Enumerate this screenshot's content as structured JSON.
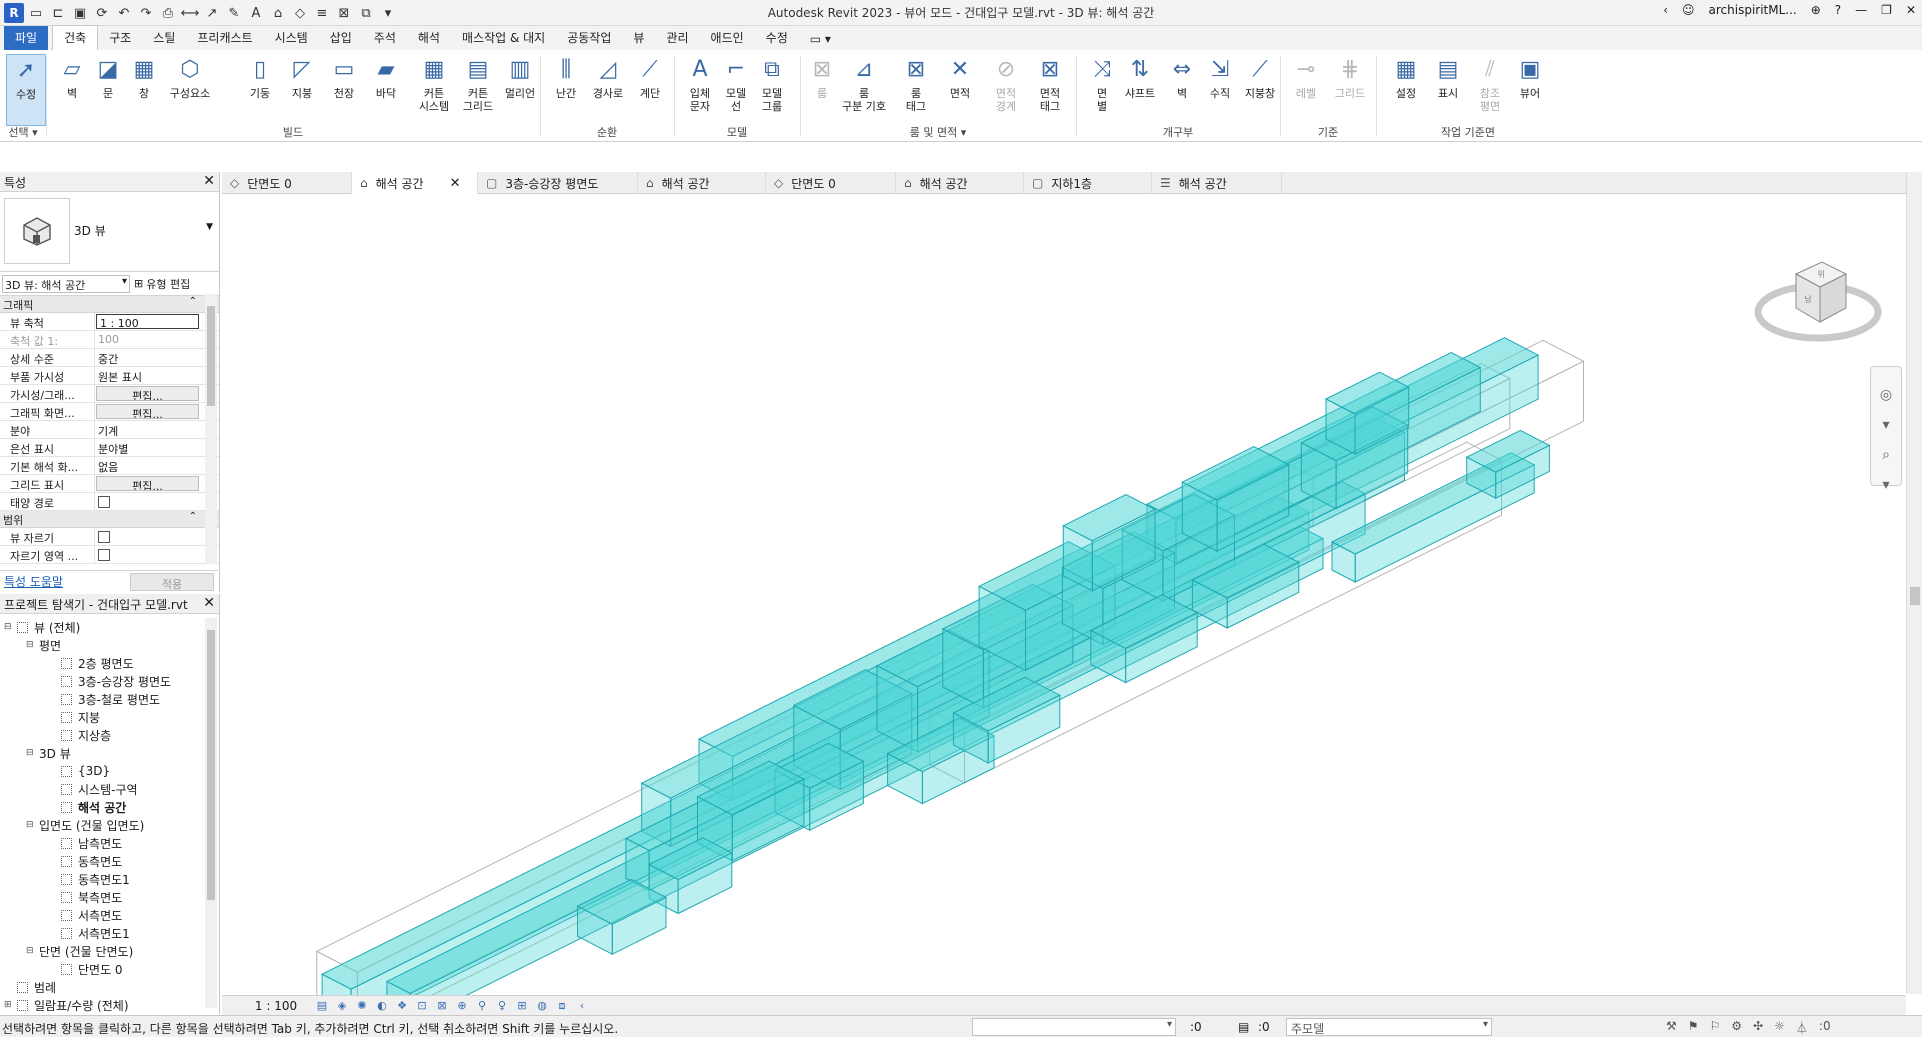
{
  "titlebar": {
    "title": "Autodesk Revit 2023 - 뷰어 모드 - 건대입구 모델.rvt - 3D 뷰: 해석 공간",
    "app_logo": "R",
    "user": "archispiritML...",
    "icons": [
      "revit-logo-icon",
      "open-icon",
      "save-icon",
      "sync-icon",
      "undo-icon",
      "redo-icon",
      "print-icon",
      "measure-icon",
      "text-icon",
      "3d-view-icon",
      "switch-windows-icon",
      "cart-icon",
      "help-icon",
      "minimize-icon",
      "restore-icon",
      "close-icon"
    ]
  },
  "ribbon_tabs": {
    "file": "파일",
    "active": "건축",
    "items": [
      "구조",
      "스틸",
      "프리캐스트",
      "시스템",
      "삽입",
      "주석",
      "해석",
      "매스작업 & 대지",
      "공동작업",
      "뷰",
      "관리",
      "애드인",
      "수정"
    ]
  },
  "ribbon": {
    "buttons": [
      {
        "label": "수정",
        "icon": "cursor-icon",
        "selected": true,
        "disabled": false
      },
      {
        "label": "벽",
        "icon": "wall-icon",
        "disabled": false
      },
      {
        "label": "문",
        "icon": "door-icon",
        "disabled": false
      },
      {
        "label": "창",
        "icon": "window-icon",
        "disabled": false
      },
      {
        "label": "구성요소",
        "icon": "component-icon",
        "disabled": false
      },
      {
        "label": "기둥",
        "icon": "column-icon",
        "disabled": false
      },
      {
        "label": "지붕",
        "icon": "roof-icon",
        "disabled": false
      },
      {
        "label": "천장",
        "icon": "ceiling-icon",
        "disabled": false
      },
      {
        "label": "바닥",
        "icon": "floor-icon",
        "disabled": false
      },
      {
        "label": "커튼\n시스템",
        "icon": "curtain-system-icon",
        "disabled": false
      },
      {
        "label": "커튼\n그리드",
        "icon": "curtain-grid-icon",
        "disabled": false
      },
      {
        "label": "멀리언",
        "icon": "mullion-icon",
        "disabled": false
      },
      {
        "label": "난간",
        "icon": "railing-icon",
        "disabled": false
      },
      {
        "label": "경사로",
        "icon": "ramp-icon",
        "disabled": false
      },
      {
        "label": "계단",
        "icon": "stair-icon",
        "disabled": false
      },
      {
        "label": "입체\n문자",
        "icon": "model-text-icon",
        "disabled": false
      },
      {
        "label": "모델\n선",
        "icon": "model-line-icon",
        "disabled": false
      },
      {
        "label": "모델\n그룹",
        "icon": "model-group-icon",
        "disabled": false
      },
      {
        "label": "룸",
        "icon": "room-icon",
        "disabled": true
      },
      {
        "label": "룸\n구분 기호",
        "icon": "room-separator-icon",
        "disabled": false
      },
      {
        "label": "룸\n태그",
        "icon": "room-tag-icon",
        "disabled": false
      },
      {
        "label": "면적",
        "icon": "area-icon",
        "disabled": false
      },
      {
        "label": "면적\n경계",
        "icon": "area-boundary-icon",
        "disabled": true
      },
      {
        "label": "면적\n태그",
        "icon": "area-tag-icon",
        "disabled": false
      },
      {
        "label": "면\n별",
        "icon": "by-face-icon",
        "disabled": false
      },
      {
        "label": "샤프트",
        "icon": "shaft-icon",
        "disabled": false
      },
      {
        "label": "벽",
        "icon": "wall-opening-icon",
        "disabled": false
      },
      {
        "label": "수직",
        "icon": "vertical-opening-icon",
        "disabled": false
      },
      {
        "label": "지붕창",
        "icon": "dormer-icon",
        "disabled": false
      },
      {
        "label": "레벨",
        "icon": "level-icon",
        "disabled": true
      },
      {
        "label": "그리드",
        "icon": "grid-icon",
        "disabled": true
      },
      {
        "label": "설정",
        "icon": "set-workplane-icon",
        "disabled": false
      },
      {
        "label": "표시",
        "icon": "show-workplane-icon",
        "disabled": false
      },
      {
        "label": "참조\n평면",
        "icon": "ref-plane-icon",
        "disabled": true
      },
      {
        "label": "뷰어",
        "icon": "viewer-icon",
        "disabled": false
      }
    ],
    "groups": [
      "선택 ▾",
      "빌드",
      "순환",
      "모델",
      "룸 및 면적 ▾",
      "개구부",
      "기준",
      "작업 기준면"
    ]
  },
  "properties": {
    "header": "특성",
    "type_name": "3D 뷰",
    "instance_selector": "3D 뷰: 해석 공간",
    "edit_type": "유형 편집",
    "sections": {
      "graphics": "그래픽",
      "extents": "범위"
    },
    "rows": [
      {
        "k": "뷰 축척",
        "v": "1 : 100",
        "style": "boxed"
      },
      {
        "k": "축척 값    1:",
        "v": "100",
        "style": "grey"
      },
      {
        "k": "상세 수준",
        "v": "중간",
        "style": ""
      },
      {
        "k": "부품 가시성",
        "v": "원본 표시",
        "style": ""
      },
      {
        "k": "가시성/그래...",
        "v": "편집...",
        "style": "btn"
      },
      {
        "k": "그래픽 화면...",
        "v": "편집...",
        "style": "btn"
      },
      {
        "k": "분야",
        "v": "기계",
        "style": ""
      },
      {
        "k": "은선 표시",
        "v": "분야별",
        "style": ""
      },
      {
        "k": "기본 해석 화...",
        "v": "없음",
        "style": ""
      },
      {
        "k": "그리드 표시",
        "v": "편집...",
        "style": "btn"
      },
      {
        "k": "태양 경로",
        "v": "",
        "style": "check"
      }
    ],
    "extent_rows": [
      {
        "k": "뷰 자르기",
        "v": "",
        "style": "check"
      },
      {
        "k": "자르기 영역 ...",
        "v": "",
        "style": "check"
      }
    ],
    "help_link": "특성 도움말",
    "apply": "적용"
  },
  "browser": {
    "header": "프로젝트 탐색기 - 건대입구 모델.rvt",
    "items": [
      {
        "label": "뷰 (전체)",
        "level": 0,
        "toggle": "⊟",
        "icon": "views-icon",
        "bold": false
      },
      {
        "label": "평면",
        "level": 1,
        "toggle": "⊟",
        "icon": "",
        "bold": false
      },
      {
        "label": "2층 평면도",
        "level": 2,
        "toggle": "",
        "icon": "view-icon",
        "bold": false
      },
      {
        "label": "3층-승강장 평면도",
        "level": 2,
        "toggle": "",
        "icon": "view-icon",
        "bold": false
      },
      {
        "label": "3층-철로 평면도",
        "level": 2,
        "toggle": "",
        "icon": "view-icon",
        "bold": false
      },
      {
        "label": "지붕",
        "level": 2,
        "toggle": "",
        "icon": "view-icon",
        "bold": false
      },
      {
        "label": "지상층",
        "level": 2,
        "toggle": "",
        "icon": "view-icon",
        "bold": false
      },
      {
        "label": "3D 뷰",
        "level": 1,
        "toggle": "⊟",
        "icon": "",
        "bold": false
      },
      {
        "label": "{3D}",
        "level": 2,
        "toggle": "",
        "icon": "view-icon",
        "bold": false
      },
      {
        "label": "시스템-구역",
        "level": 2,
        "toggle": "",
        "icon": "view-icon",
        "bold": false
      },
      {
        "label": "해석 공간",
        "level": 2,
        "toggle": "",
        "icon": "view-icon",
        "bold": true
      },
      {
        "label": "입면도 (건물 입면도)",
        "level": 1,
        "toggle": "⊟",
        "icon": "",
        "bold": false
      },
      {
        "label": "남측면도",
        "level": 2,
        "toggle": "",
        "icon": "view-icon",
        "bold": false
      },
      {
        "label": "동측면도",
        "level": 2,
        "toggle": "",
        "icon": "view-icon",
        "bold": false
      },
      {
        "label": "동측면도1",
        "level": 2,
        "toggle": "",
        "icon": "view-icon",
        "bold": false
      },
      {
        "label": "북측면도",
        "level": 2,
        "toggle": "",
        "icon": "view-icon",
        "bold": false
      },
      {
        "label": "서측면도",
        "level": 2,
        "toggle": "",
        "icon": "view-icon",
        "bold": false
      },
      {
        "label": "서측면도1",
        "level": 2,
        "toggle": "",
        "icon": "view-icon",
        "bold": false
      },
      {
        "label": "단면 (건물 단면도)",
        "level": 1,
        "toggle": "⊟",
        "icon": "",
        "bold": false
      },
      {
        "label": "단면도 0",
        "level": 2,
        "toggle": "",
        "icon": "view-icon",
        "bold": false
      },
      {
        "label": "범례",
        "level": 0,
        "toggle": "",
        "icon": "legend-icon",
        "bold": false
      },
      {
        "label": "일람표/수량 (전체)",
        "level": 0,
        "toggle": "⊞",
        "icon": "schedule-icon",
        "bold": false
      }
    ]
  },
  "view_tabs": [
    {
      "label": "단면도 0",
      "icon": "◇",
      "active": false
    },
    {
      "label": "해석 공간",
      "icon": "⌂",
      "active": true
    },
    {
      "label": "3층-승강장 평면도",
      "icon": "▢",
      "active": false
    },
    {
      "label": "해석 공간",
      "icon": "⌂",
      "active": false
    },
    {
      "label": "단면도 0",
      "icon": "◇",
      "active": false
    },
    {
      "label": "해석 공간",
      "icon": "⌂",
      "active": false
    },
    {
      "label": "지하1층",
      "icon": "▢",
      "active": false
    },
    {
      "label": "해석 공간",
      "icon": "☰",
      "active": false
    }
  ],
  "viewcube": {
    "face_top": "위",
    "face_front": "남"
  },
  "view_control": {
    "scale": "1 : 100"
  },
  "statusbar": {
    "message": "선택하려면 항목을 클릭하고, 다른 항목을 선택하려면 Tab 키, 추가하려면 Ctrl 키, 선택 취소하려면 Shift 키를 누르십시오.",
    "count1": ":0",
    "count2": ":0",
    "model": "주모델",
    "filter_count": ":0"
  },
  "colors": {
    "accent": "#2c6cc4",
    "space_fill": "#4fd6d6",
    "space_edge": "#1fa9b3",
    "selected_button": "#cde4f7"
  }
}
